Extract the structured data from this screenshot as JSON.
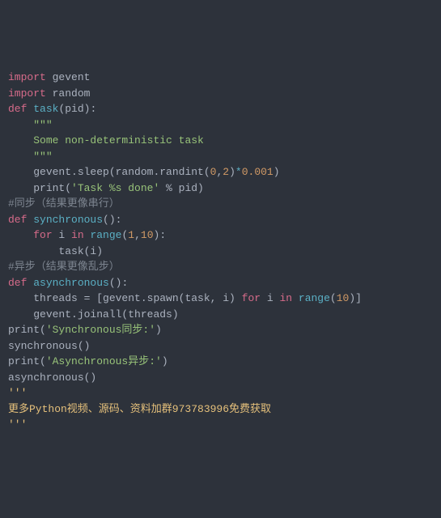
{
  "code": {
    "l1": {
      "k1": "import",
      "m1": " gevent"
    },
    "l2": {
      "k1": "import",
      "m1": " random"
    },
    "l3": "",
    "l4": {
      "k1": "def ",
      "f": "task",
      "p": "(pid):"
    },
    "l5": {
      "pad": "    ",
      "s": "\"\"\""
    },
    "l6": {
      "pad": "    ",
      "s": "Some non-deterministic task"
    },
    "l7": {
      "pad": "    ",
      "s": "\"\"\""
    },
    "l8": {
      "pad": "    ",
      "a": "gevent.sleep(random.randint(",
      "n1": "0",
      "c1": ",",
      "n2": "2",
      "c2": ")",
      "op": "*",
      "n3": "0.001",
      "e": ")"
    },
    "l9": {
      "pad": "    ",
      "a": "print(",
      "s": "'Task %s done'",
      "b": " % pid)"
    },
    "l10": "",
    "l11": {
      "c": "#同步（结果更像串行）"
    },
    "l12": {
      "k1": "def ",
      "f": "synchronous",
      "p": "():"
    },
    "l13": {
      "pad": "    ",
      "k1": "for",
      "a": " i ",
      "k2": "in",
      "b": " ",
      "fn": "range",
      "c": "(",
      "n1": "1",
      "d": ",",
      "n2": "10",
      "e": "):"
    },
    "l14": {
      "pad": "        ",
      "a": "task(i)"
    },
    "l15": "",
    "l16": {
      "c": "#异步（结果更像乱步）"
    },
    "l17": {
      "k1": "def ",
      "f": "asynchronous",
      "p": "():"
    },
    "l18": {
      "pad": "    ",
      "a": "threads = [gevent.spawn(task, i) ",
      "k1": "for",
      "b": " i ",
      "k2": "in",
      "c": " ",
      "fn": "range",
      "d": "(",
      "n1": "10",
      "e": ")]"
    },
    "l19": {
      "pad": "    ",
      "a": "gevent.joinall(threads)"
    },
    "l20": "",
    "l21": {
      "a": "print(",
      "s": "'Synchronous同步:'",
      "b": ")"
    },
    "l22": {
      "a": "synchronous()"
    },
    "l23": "",
    "l24": {
      "a": "print(",
      "s": "'Asynchronous异步:'",
      "b": ")"
    },
    "l25": {
      "a": "asynchronous()"
    },
    "l26": {
      "s": "'''"
    },
    "l27": {
      "s": "更多Python视频、源码、资料加群973783996免费获取"
    },
    "l28": {
      "s": "'''"
    }
  }
}
